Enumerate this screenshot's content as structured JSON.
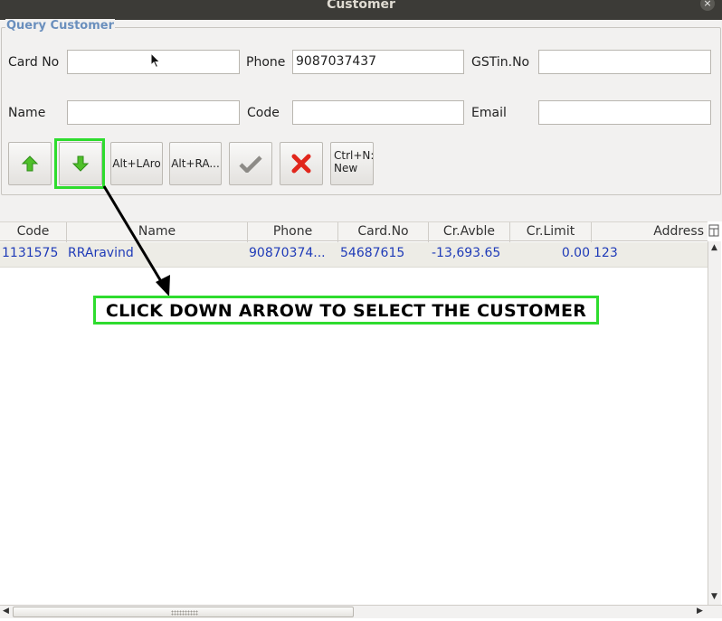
{
  "window": {
    "title": "Customer",
    "close_glyph": "×"
  },
  "query": {
    "legend": "Query Customer",
    "card_no": {
      "label": "Card No",
      "value": ""
    },
    "phone": {
      "label": "Phone",
      "value": "9087037437"
    },
    "gstin": {
      "label": "GSTin.No",
      "value": ""
    },
    "name": {
      "label": "Name",
      "value": ""
    },
    "code": {
      "label": "Code",
      "value": ""
    },
    "email": {
      "label": "Email",
      "value": ""
    }
  },
  "toolbar": {
    "up_icon": "up-arrow-icon",
    "down_icon": "down-arrow-icon",
    "alt_l_label": "Alt+LAro",
    "alt_r_label": "Alt+RA...",
    "ok_icon": "check-icon",
    "cancel_icon": "red-x-icon",
    "new_label_line1": "Ctrl+N:",
    "new_label_line2": "New"
  },
  "table": {
    "columns": [
      "Code",
      "Name",
      "Phone",
      "Card.No",
      "Cr.Avble",
      "Cr.Limit",
      "Address"
    ],
    "rows": [
      {
        "code": "1131575",
        "name": "RRAravind",
        "phone": "90870374...",
        "card_no": "54687615",
        "cr_avble": "-13,693.65",
        "cr_limit": "0.00",
        "address": "123"
      }
    ]
  },
  "annotation": {
    "text": "CLICK DOWN ARROW TO SELECT THE CUSTOMER",
    "color": "#2edc2e"
  }
}
